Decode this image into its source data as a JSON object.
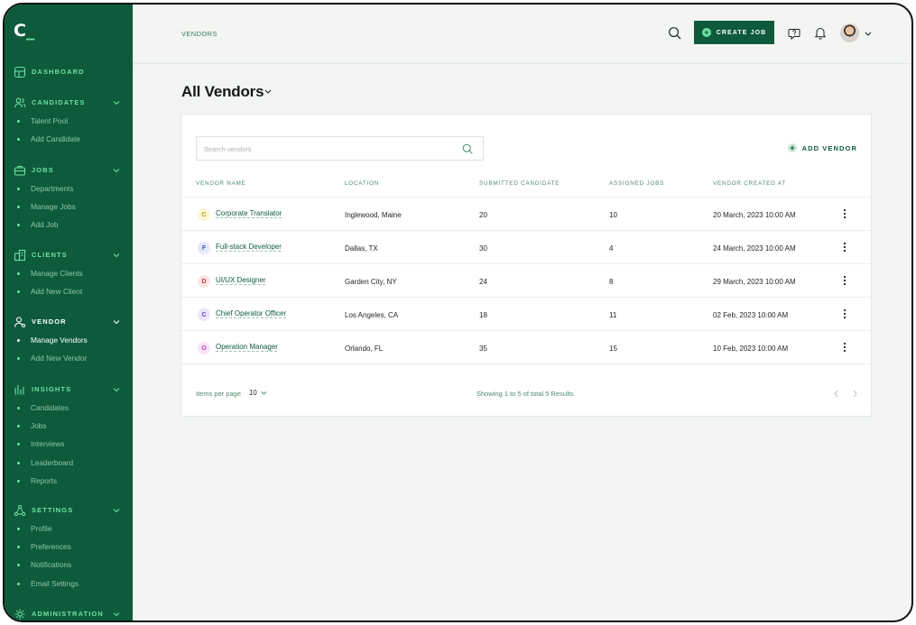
{
  "app": {
    "logo_main": "C",
    "logo_cursor": "_"
  },
  "sidebar": {
    "sections": [
      {
        "label": "DASHBOARD",
        "icon": "dashboard-icon",
        "expandable": false,
        "items": []
      },
      {
        "label": "CANDIDATES",
        "icon": "users-icon",
        "expandable": true,
        "items": [
          "Talent Pool",
          "Add Candidate"
        ]
      },
      {
        "label": "JOBS",
        "icon": "briefcase-icon",
        "expandable": true,
        "items": [
          "Departments",
          "Manage Jobs",
          "Add Job"
        ]
      },
      {
        "label": "CLIENTS",
        "icon": "building-icon",
        "expandable": true,
        "items": [
          "Manage Clients",
          "Add New Client"
        ]
      },
      {
        "label": "VENDOR",
        "icon": "user-gear-icon",
        "expandable": true,
        "active": true,
        "items": [
          "Manage Vendors",
          "Add New Vendor"
        ],
        "active_item": 0
      },
      {
        "label": "INSIGHTS",
        "icon": "bar-chart-icon",
        "expandable": true,
        "items": [
          "Candidates",
          "Jobs",
          "Interviews",
          "Leaderboard",
          "Reports"
        ]
      },
      {
        "label": "SETTINGS",
        "icon": "network-icon",
        "expandable": true,
        "items": [
          "Profile",
          "Preferences",
          "Notifications",
          "Email Settings"
        ]
      },
      {
        "label": "ADMINISTRATION",
        "icon": "admin-gear-icon",
        "expandable": true,
        "items": []
      }
    ]
  },
  "header": {
    "breadcrumb": "VENDORS",
    "create_job_label": "CREATE JOB"
  },
  "page": {
    "title": "All Vendors"
  },
  "vendors": {
    "search_placeholder": "Search vendors",
    "add_label": "ADD VENDOR",
    "columns": {
      "name": "VENDOR NAME",
      "location": "LOCATION",
      "submitted": "SUBMITTED CANDIDATE",
      "assigned": "ASSIGNED JOBS",
      "created": "VENDOR CREATED AT"
    },
    "rows": [
      {
        "initial": "C",
        "name": "Corporate Translator",
        "location": "Inglewood, Maine",
        "submitted": "20",
        "assigned": "10",
        "created": "20 March, 2023 10:00 AM",
        "color": "#b8a100",
        "bg": "#fbf6d9"
      },
      {
        "initial": "F",
        "name": "Full-stack Developer",
        "location": "Dallas, TX",
        "submitted": "30",
        "assigned": "4",
        "created": "24 March, 2023 10:00 AM",
        "color": "#3d5bd6",
        "bg": "#e5eafb"
      },
      {
        "initial": "D",
        "name": "UI/UX Designer",
        "location": "Garden City, NY",
        "submitted": "24",
        "assigned": "8",
        "created": "29 March, 2023 10:00 AM",
        "color": "#d43c3c",
        "bg": "#fbe5e5"
      },
      {
        "initial": "C",
        "name": "Chief Operator Officer",
        "location": "Los Angeles, CA",
        "submitted": "18",
        "assigned": "11",
        "created": "02 Feb, 2023 10:00 AM",
        "color": "#6b3fd8",
        "bg": "#ece6fb"
      },
      {
        "initial": "O",
        "name": "Operation Manager",
        "location": "Orlando, FL",
        "submitted": "35",
        "assigned": "15",
        "created": "10 Feb, 2023 10:00 AM",
        "color": "#b93cc2",
        "bg": "#f8e5fa"
      }
    ]
  },
  "pagination": {
    "items_per_page_label": "Items per page",
    "items_per_page_value": "10",
    "showing_text": "Showing 1 to 5 of total 5 Results"
  },
  "colors": {
    "brand": "#0d5b3b",
    "accent": "#6fe0a2",
    "muted": "#4c8a6a"
  }
}
